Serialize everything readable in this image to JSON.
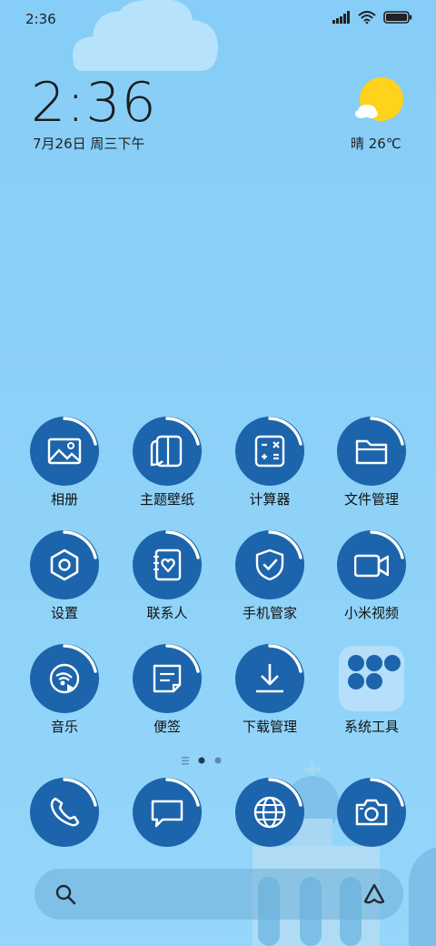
{
  "status_bar": {
    "time": "2:36",
    "icons": [
      "signal-icon",
      "wifi-icon",
      "battery-icon"
    ]
  },
  "clock_widget": {
    "time": "2:36",
    "date": "7月26日 周三下午"
  },
  "weather_widget": {
    "condition": "晴",
    "temperature": "26℃",
    "text": "晴 26℃",
    "icon": "sun-cloud-icon"
  },
  "apps": [
    {
      "label": "相册",
      "icon": "gallery-icon"
    },
    {
      "label": "主题壁纸",
      "icon": "themes-icon"
    },
    {
      "label": "计算器",
      "icon": "calculator-icon"
    },
    {
      "label": "文件管理",
      "icon": "folder-icon"
    },
    {
      "label": "设置",
      "icon": "settings-icon"
    },
    {
      "label": "联系人",
      "icon": "contacts-icon"
    },
    {
      "label": "手机管家",
      "icon": "security-icon"
    },
    {
      "label": "小米视频",
      "icon": "video-icon"
    },
    {
      "label": "音乐",
      "icon": "music-icon"
    },
    {
      "label": "便签",
      "icon": "notes-icon"
    },
    {
      "label": "下载管理",
      "icon": "download-icon"
    },
    {
      "label": "系统工具",
      "icon": "folder-tools-icon"
    }
  ],
  "pager": {
    "pages": 3,
    "active": 2
  },
  "dock": [
    {
      "icon": "phone-icon"
    },
    {
      "icon": "messages-icon"
    },
    {
      "icon": "browser-icon"
    },
    {
      "icon": "camera-icon"
    }
  ],
  "search_bar": {
    "left_icon": "search-icon",
    "right_icon": "assistant-icon"
  },
  "colors": {
    "background": "#8ed2f8",
    "icon_circle": "#1c64ab",
    "ring": "#ffffff"
  }
}
